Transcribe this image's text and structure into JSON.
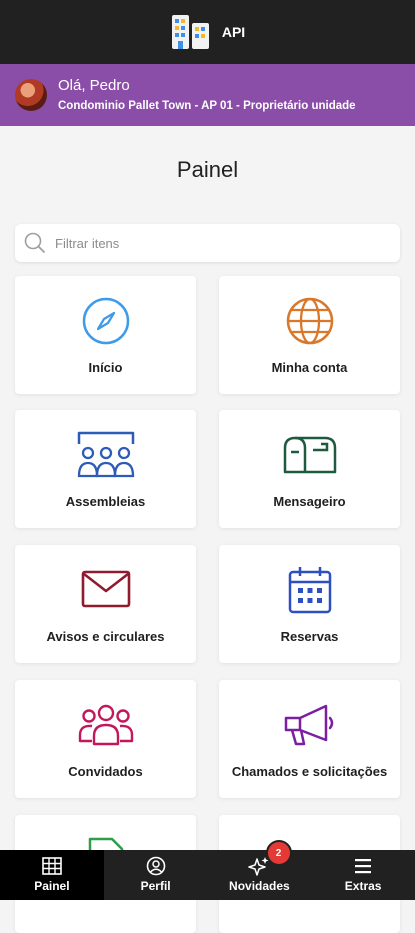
{
  "header": {
    "app_name": "API",
    "logo_icon": "building-logo-icon"
  },
  "user": {
    "greeting": "Olá, Pedro",
    "subtitle": "Condominio Pallet Town - AP 01 - Proprietário unidade",
    "bar_color": "#8a4ea8"
  },
  "page": {
    "title": "Painel"
  },
  "search": {
    "placeholder": "Filtrar itens",
    "value": ""
  },
  "cards": [
    {
      "label": "Início",
      "icon": "compass-icon",
      "color": "#3d9be9"
    },
    {
      "label": "Minha conta",
      "icon": "globe-icon",
      "color": "#d9782b"
    },
    {
      "label": "Assembleias",
      "icon": "assembly-icon",
      "color": "#2d5bb8"
    },
    {
      "label": "Mensageiro",
      "icon": "mailbox-icon",
      "color": "#1e5a40"
    },
    {
      "label": "Avisos e circulares",
      "icon": "envelope-icon",
      "color": "#8e1b2e"
    },
    {
      "label": "Reservas",
      "icon": "calendar-icon",
      "color": "#2d4fbf"
    },
    {
      "label": "Convidados",
      "icon": "guests-icon",
      "color": "#c2185b"
    },
    {
      "label": "Chamados e solicitações",
      "icon": "megaphone-icon",
      "color": "#7b1fa2"
    }
  ],
  "nav": {
    "items": [
      {
        "label": "Painel",
        "icon": "grid-icon"
      },
      {
        "label": "Perfil",
        "icon": "profile-icon"
      },
      {
        "label": "Novidades",
        "icon": "sparkles-icon",
        "badge": "2"
      },
      {
        "label": "Extras",
        "icon": "menu-icon"
      }
    ]
  }
}
